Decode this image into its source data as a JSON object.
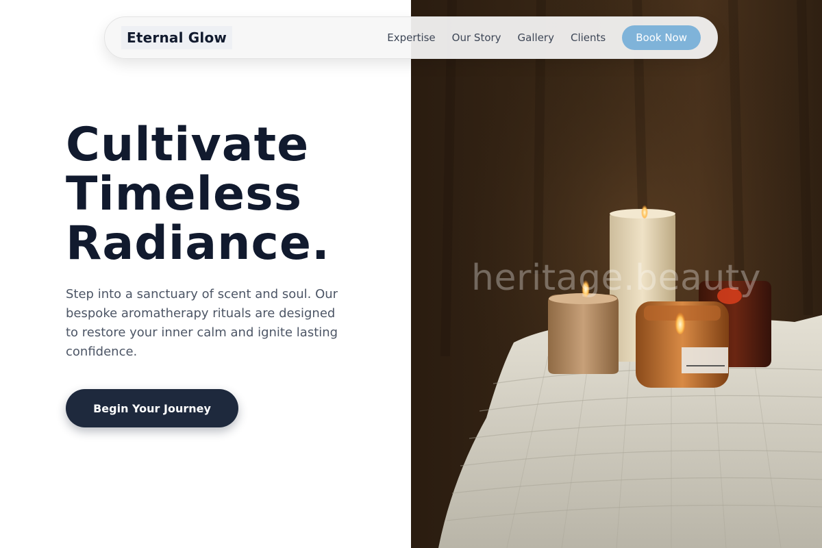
{
  "brand": {
    "name": "Eternal Glow"
  },
  "nav": {
    "links": [
      "Expertise",
      "Our Story",
      "Gallery",
      "Clients"
    ],
    "cta_label": "Book Now"
  },
  "hero": {
    "headline_lines": [
      "Cultivate",
      "Timeless",
      "Radiance."
    ],
    "subtext": "Step into a sanctuary of scent and soul. Our bespoke aromatherapy rituals are designed to restore your inner calm and ignite lasting confidence.",
    "cta_label": "Begin Your Journey"
  },
  "image": {
    "watermark": "heritage.beauty",
    "jar_label": "",
    "description_icon": "candles-image"
  },
  "colors": {
    "text_dark": "#111a2e",
    "accent": "#7fb3d9",
    "cta_bg": "#1e293d",
    "body_text": "#4c5565"
  }
}
